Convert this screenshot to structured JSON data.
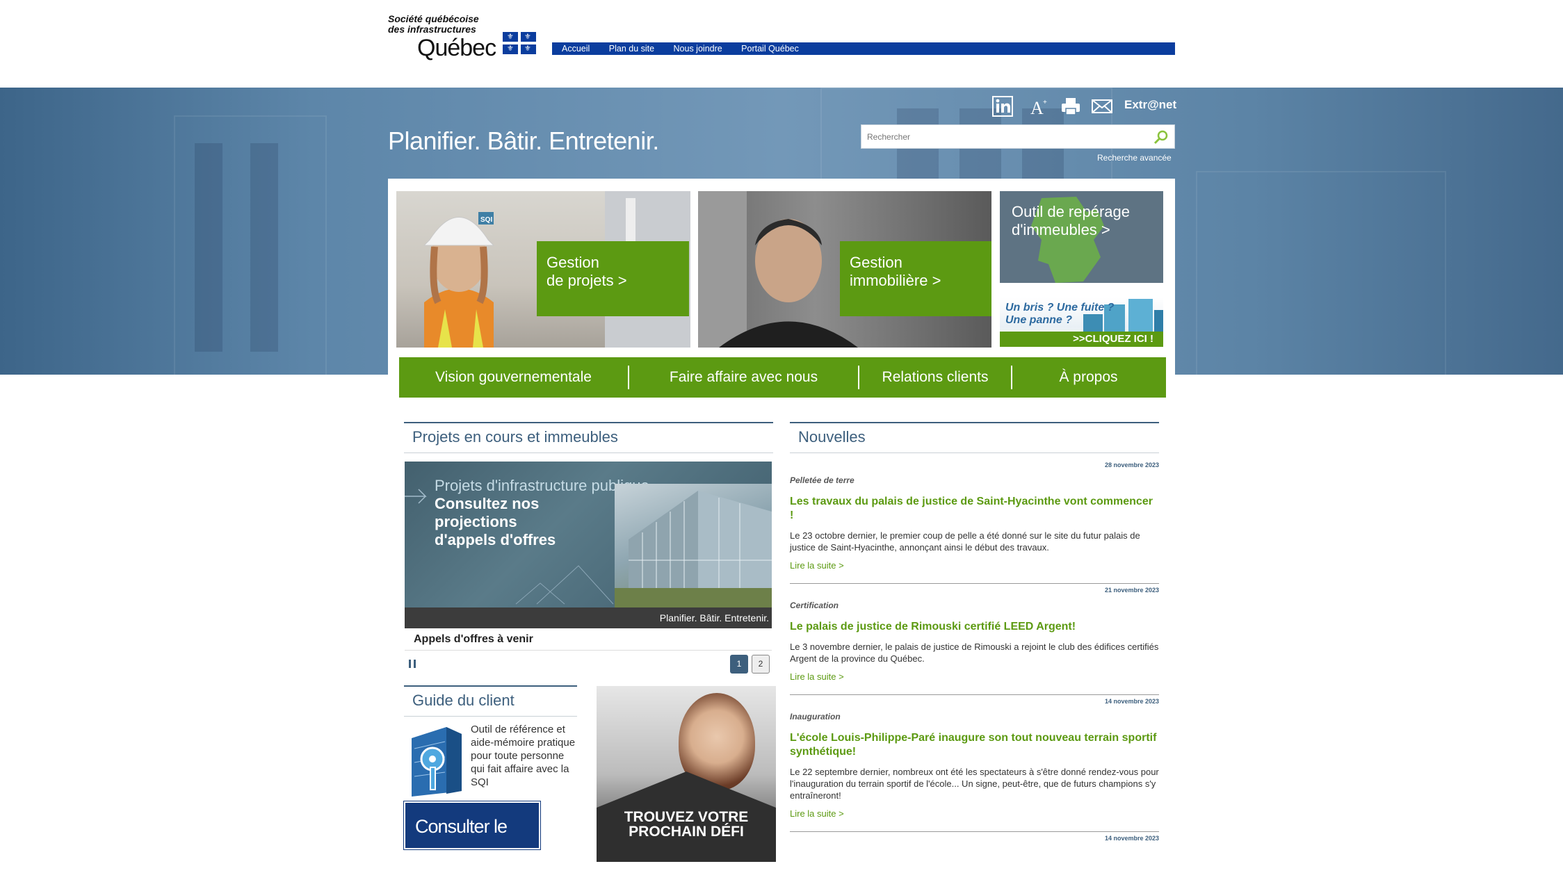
{
  "header": {
    "logo_line1": "Société québécoise",
    "logo_line2": "des infrastructures",
    "logo_line3": "Québec",
    "top_nav": [
      "Accueil",
      "Plan du site",
      "Nous joindre",
      "Portail Québec"
    ]
  },
  "hero": {
    "tagline": "Planifier. Bâtir. Entretenir.",
    "extranet_label": "Extr@net",
    "search_placeholder": "Rechercher",
    "advanced_search": "Recherche avancée"
  },
  "features": {
    "project_mgmt": [
      "Gestion",
      "de projets >"
    ],
    "property_mgmt": [
      "Gestion",
      "immobilière >"
    ],
    "locator": [
      "Outil de repérage",
      "d'immeubles >"
    ],
    "breakdown_q1": "Un bris ? Une fuite ?",
    "breakdown_q2": "Une panne ?",
    "breakdown_cta": ">>CLIQUEZ ICI !",
    "helmet_badge": "SQI"
  },
  "main_nav": [
    "Vision gouvernementale",
    "Faire affaire avec nous",
    "Relations clients",
    "À propos"
  ],
  "projects": {
    "heading": "Projets en cours et immeubles",
    "slide_line1": "Projets d'infrastructure publique",
    "slide_line2": "Consultez nos projections",
    "slide_line3": "d'appels d'offres",
    "slide_footer": "Planifier. Bâtir. Entretenir.",
    "caption": "Appels d'offres à venir",
    "pages": [
      "1",
      "2"
    ],
    "current_page": 1
  },
  "guide": {
    "heading": "Guide du client",
    "text": "Outil de référence et aide-mémoire pratique pour toute personne qui fait affaire avec la SQI",
    "button": "Consulter le guide"
  },
  "career": {
    "line1": "TROUVEZ VOTRE",
    "line2": "PROCHAIN DÉFI"
  },
  "news": {
    "heading": "Nouvelles",
    "items": [
      {
        "date": "28 novembre 2023",
        "category": "Pelletée de terre",
        "title": "Les travaux du palais de justice de Saint-Hyacinthe vont commencer !",
        "summary": "Le 23 octobre dernier, le premier coup de pelle a été donné sur le site du futur palais de justice de Saint-Hyacinthe, annonçant ainsi le début des travaux.",
        "more": "Lire la suite >"
      },
      {
        "date": "21 novembre 2023",
        "category": "Certification",
        "title": "Le palais de justice de Rimouski certifié LEED Argent!",
        "summary": "Le 3 novembre dernier, le palais de justice de Rimouski a rejoint le club des édifices certifiés Argent de la province du Québec.",
        "more": "Lire la suite >"
      },
      {
        "date": "14 novembre 2023",
        "category": "Inauguration",
        "title": "L'école Louis-Philippe-Paré inaugure son tout nouveau terrain sportif synthétique!",
        "summary": "Le 22 septembre dernier, nombreux ont été les spectateurs à s'être donné rendez-vous pour l'inauguration du terrain sportif de l'école... Un signe, peut-être, que de futurs champions s'y entraîneront!",
        "more": "Lire la suite >"
      }
    ],
    "next_date": "14 novembre 2023"
  },
  "colors": {
    "green": "#5c9a12",
    "blue_nav": "#0b3d9e",
    "slate": "#3d5f7d"
  }
}
